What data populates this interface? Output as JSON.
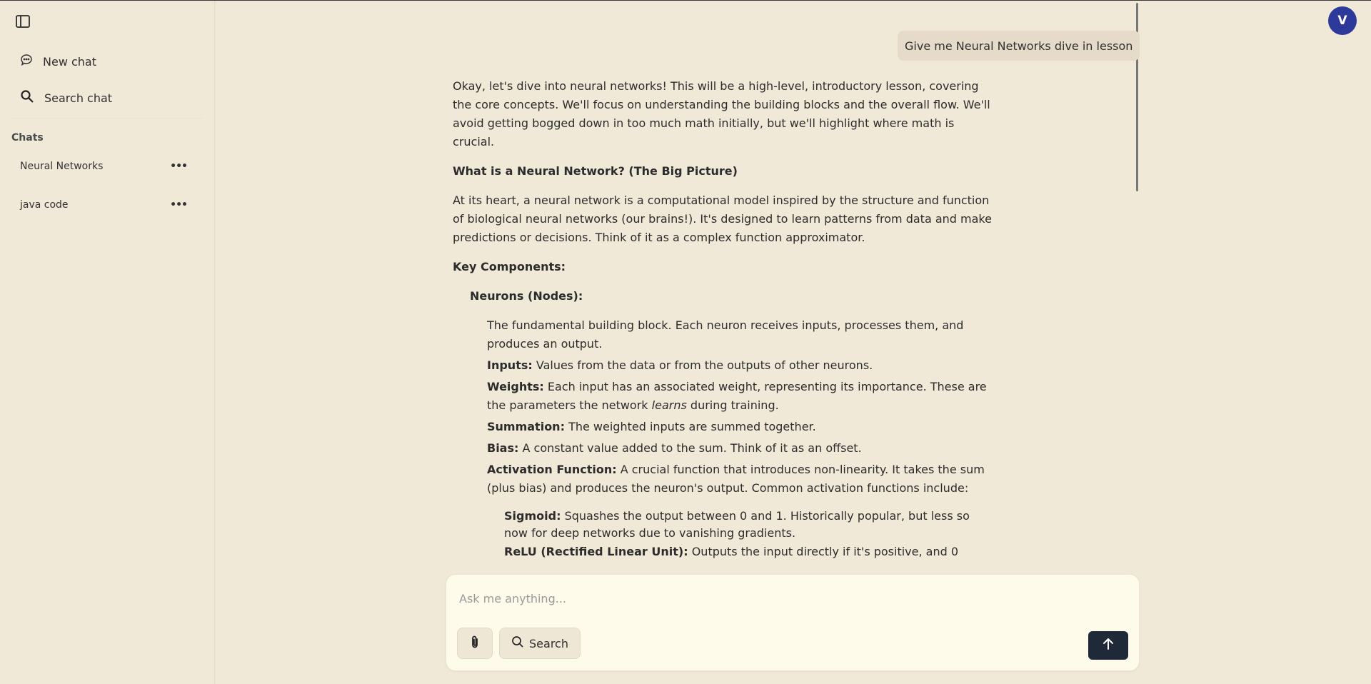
{
  "sidebar": {
    "new_chat_label": "New chat",
    "search_chat_label": "Search chat",
    "chats_heading": "Chats",
    "chats": [
      {
        "title": "Neural Networks"
      },
      {
        "title": "java code"
      }
    ],
    "more_label": "•••"
  },
  "user": {
    "avatar_initial": "V"
  },
  "conversation": {
    "user_message": "Give me Neural Networks dive in lesson",
    "intro": "Okay, let's dive into neural networks! This will be a high-level, introductory lesson, covering the core concepts. We'll focus on understanding the building blocks and the overall flow. We'll avoid getting bogged down in too much math initially, but we'll highlight where math is crucial.",
    "big_picture_heading": "What is a Neural Network? (The Big Picture)",
    "big_picture_text": "At its heart, a neural network is a computational model inspired by the structure and function of biological neural networks (our brains!). It's designed to learn patterns from data and make predictions or decisions. Think of it as a complex function approximator.",
    "key_components_heading": "Key Components:",
    "neurons_heading": "Neurons (Nodes):",
    "neurons_text": "The fundamental building block. Each neuron receives inputs, processes them, and produces an output.",
    "inputs_label": "Inputs:",
    "inputs_text": "Values from the data or from the outputs of other neurons.",
    "weights_label": "Weights:",
    "weights_text_a": "Each input has an associated weight, representing its importance. These are the parameters the network",
    "weights_text_em": "learns",
    "weights_text_b": "during training.",
    "summation_label": "Summation:",
    "summation_text": "The weighted inputs are summed together.",
    "bias_label": "Bias:",
    "bias_text": "A constant value added to the sum. Think of it as an offset.",
    "activation_label": "Activation Function:",
    "activation_text": "A crucial function that introduces non-linearity. It takes the sum (plus bias) and produces the neuron's output. Common activation functions include:",
    "sigmoid_label": "Sigmoid:",
    "sigmoid_text": "Squashes the output between 0 and 1. Historically popular, but less so now for deep networks due to vanishing gradients.",
    "relu_label": "ReLU (Rectified Linear Unit):",
    "relu_text": "Outputs the input directly if it's positive, and 0"
  },
  "composer": {
    "placeholder": "Ask me anything...",
    "search_label": "Search"
  },
  "icons": {
    "sidebar_toggle": "sidebar-toggle-icon",
    "new_chat": "chat-bubble-icon",
    "search": "search-icon",
    "attach": "paperclip-icon",
    "send": "arrow-up-icon"
  },
  "colors": {
    "background": "#f1e9d8",
    "avatar": "#2d3a9a",
    "send_button": "#1f2937",
    "composer": "#fffbea"
  }
}
